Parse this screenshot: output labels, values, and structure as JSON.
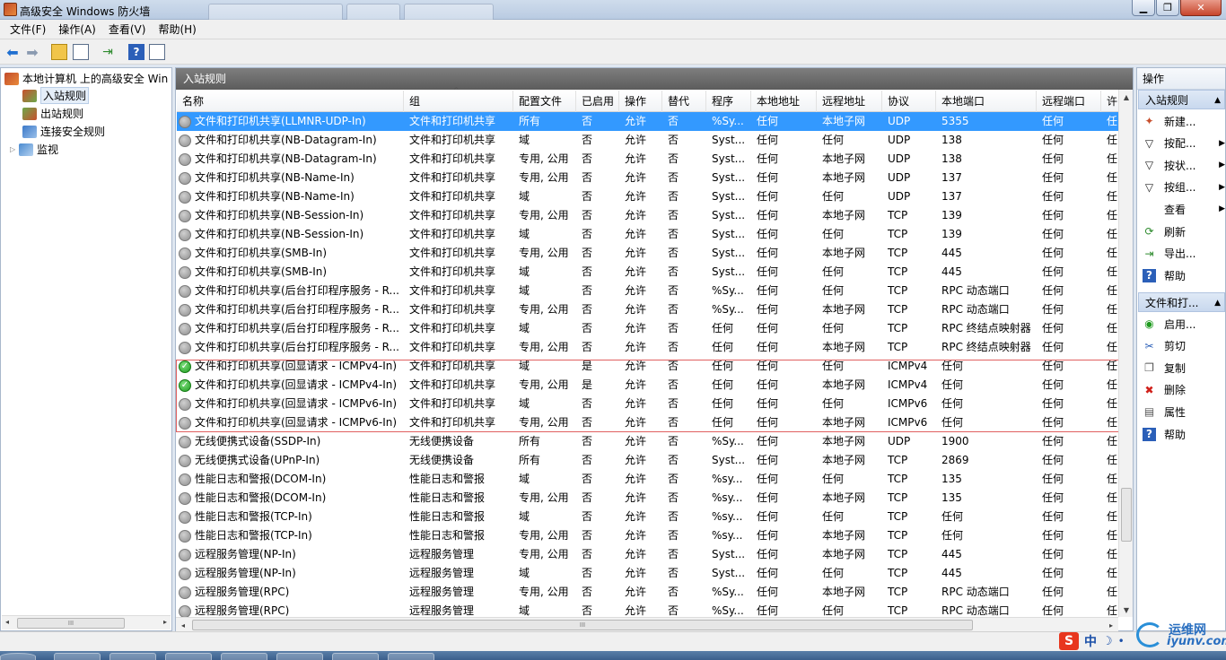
{
  "window": {
    "title": "高级安全 Windows 防火墙"
  },
  "menu": [
    "文件(F)",
    "操作(A)",
    "查看(V)",
    "帮助(H)"
  ],
  "tree": {
    "root": "本地计算机 上的高级安全 Win",
    "items": [
      {
        "label": "入站规则",
        "selected": true
      },
      {
        "label": "出站规则",
        "selected": false
      },
      {
        "label": "连接安全规则",
        "selected": false
      },
      {
        "label": "监视",
        "selected": false
      }
    ],
    "scroll_grip": "III"
  },
  "center": {
    "title": "入站规则",
    "columns": [
      "名称",
      "组",
      "配置文件",
      "已启用",
      "操作",
      "替代",
      "程序",
      "本地地址",
      "远程地址",
      "协议",
      "本地端口",
      "远程端口",
      "许"
    ],
    "scroll_grip": "III",
    "rows": [
      {
        "e": false,
        "v": [
          "文件和打印机共享(LLMNR-UDP-In)",
          "文件和打印机共享",
          "所有",
          "否",
          "允许",
          "否",
          "%Sy...",
          "任何",
          "本地子网",
          "UDP",
          "5355",
          "任何",
          "任"
        ]
      },
      {
        "e": false,
        "v": [
          "文件和打印机共享(NB-Datagram-In)",
          "文件和打印机共享",
          "域",
          "否",
          "允许",
          "否",
          "Syst...",
          "任何",
          "任何",
          "UDP",
          "138",
          "任何",
          "任"
        ]
      },
      {
        "e": false,
        "v": [
          "文件和打印机共享(NB-Datagram-In)",
          "文件和打印机共享",
          "专用, 公用",
          "否",
          "允许",
          "否",
          "Syst...",
          "任何",
          "本地子网",
          "UDP",
          "138",
          "任何",
          "任"
        ]
      },
      {
        "e": false,
        "v": [
          "文件和打印机共享(NB-Name-In)",
          "文件和打印机共享",
          "专用, 公用",
          "否",
          "允许",
          "否",
          "Syst...",
          "任何",
          "本地子网",
          "UDP",
          "137",
          "任何",
          "任"
        ]
      },
      {
        "e": false,
        "v": [
          "文件和打印机共享(NB-Name-In)",
          "文件和打印机共享",
          "域",
          "否",
          "允许",
          "否",
          "Syst...",
          "任何",
          "任何",
          "UDP",
          "137",
          "任何",
          "任"
        ]
      },
      {
        "e": false,
        "v": [
          "文件和打印机共享(NB-Session-In)",
          "文件和打印机共享",
          "专用, 公用",
          "否",
          "允许",
          "否",
          "Syst...",
          "任何",
          "本地子网",
          "TCP",
          "139",
          "任何",
          "任"
        ]
      },
      {
        "e": false,
        "v": [
          "文件和打印机共享(NB-Session-In)",
          "文件和打印机共享",
          "域",
          "否",
          "允许",
          "否",
          "Syst...",
          "任何",
          "任何",
          "TCP",
          "139",
          "任何",
          "任"
        ]
      },
      {
        "e": false,
        "v": [
          "文件和打印机共享(SMB-In)",
          "文件和打印机共享",
          "专用, 公用",
          "否",
          "允许",
          "否",
          "Syst...",
          "任何",
          "本地子网",
          "TCP",
          "445",
          "任何",
          "任"
        ]
      },
      {
        "e": false,
        "v": [
          "文件和打印机共享(SMB-In)",
          "文件和打印机共享",
          "域",
          "否",
          "允许",
          "否",
          "Syst...",
          "任何",
          "任何",
          "TCP",
          "445",
          "任何",
          "任"
        ]
      },
      {
        "e": false,
        "v": [
          "文件和打印机共享(后台打印程序服务 - R...",
          "文件和打印机共享",
          "域",
          "否",
          "允许",
          "否",
          "%Sy...",
          "任何",
          "任何",
          "TCP",
          "RPC 动态端口",
          "任何",
          "任"
        ]
      },
      {
        "e": false,
        "v": [
          "文件和打印机共享(后台打印程序服务 - R...",
          "文件和打印机共享",
          "专用, 公用",
          "否",
          "允许",
          "否",
          "%Sy...",
          "任何",
          "本地子网",
          "TCP",
          "RPC 动态端口",
          "任何",
          "任"
        ]
      },
      {
        "e": false,
        "v": [
          "文件和打印机共享(后台打印程序服务 - R...",
          "文件和打印机共享",
          "域",
          "否",
          "允许",
          "否",
          "任何",
          "任何",
          "任何",
          "TCP",
          "RPC 终结点映射器",
          "任何",
          "任"
        ]
      },
      {
        "e": false,
        "v": [
          "文件和打印机共享(后台打印程序服务 - R...",
          "文件和打印机共享",
          "专用, 公用",
          "否",
          "允许",
          "否",
          "任何",
          "任何",
          "本地子网",
          "TCP",
          "RPC 终结点映射器",
          "任何",
          "任"
        ]
      },
      {
        "e": true,
        "v": [
          "文件和打印机共享(回显请求 - ICMPv4-In)",
          "文件和打印机共享",
          "域",
          "是",
          "允许",
          "否",
          "任何",
          "任何",
          "任何",
          "ICMPv4",
          "任何",
          "任何",
          "任"
        ]
      },
      {
        "e": true,
        "v": [
          "文件和打印机共享(回显请求 - ICMPv4-In)",
          "文件和打印机共享",
          "专用, 公用",
          "是",
          "允许",
          "否",
          "任何",
          "任何",
          "本地子网",
          "ICMPv4",
          "任何",
          "任何",
          "任"
        ]
      },
      {
        "e": false,
        "v": [
          "文件和打印机共享(回显请求 - ICMPv6-In)",
          "文件和打印机共享",
          "域",
          "否",
          "允许",
          "否",
          "任何",
          "任何",
          "任何",
          "ICMPv6",
          "任何",
          "任何",
          "任"
        ]
      },
      {
        "e": false,
        "v": [
          "文件和打印机共享(回显请求 - ICMPv6-In)",
          "文件和打印机共享",
          "专用, 公用",
          "否",
          "允许",
          "否",
          "任何",
          "任何",
          "本地子网",
          "ICMPv6",
          "任何",
          "任何",
          "任"
        ]
      },
      {
        "e": false,
        "v": [
          "无线便携式设备(SSDP-In)",
          "无线便携设备",
          "所有",
          "否",
          "允许",
          "否",
          "%Sy...",
          "任何",
          "本地子网",
          "UDP",
          "1900",
          "任何",
          "任"
        ]
      },
      {
        "e": false,
        "v": [
          "无线便携式设备(UPnP-In)",
          "无线便携设备",
          "所有",
          "否",
          "允许",
          "否",
          "Syst...",
          "任何",
          "本地子网",
          "TCP",
          "2869",
          "任何",
          "任"
        ]
      },
      {
        "e": false,
        "v": [
          "性能日志和警报(DCOM-In)",
          "性能日志和警报",
          "域",
          "否",
          "允许",
          "否",
          "%sy...",
          "任何",
          "任何",
          "TCP",
          "135",
          "任何",
          "任"
        ]
      },
      {
        "e": false,
        "v": [
          "性能日志和警报(DCOM-In)",
          "性能日志和警报",
          "专用, 公用",
          "否",
          "允许",
          "否",
          "%sy...",
          "任何",
          "本地子网",
          "TCP",
          "135",
          "任何",
          "任"
        ]
      },
      {
        "e": false,
        "v": [
          "性能日志和警报(TCP-In)",
          "性能日志和警报",
          "域",
          "否",
          "允许",
          "否",
          "%sy...",
          "任何",
          "任何",
          "TCP",
          "任何",
          "任何",
          "任"
        ]
      },
      {
        "e": false,
        "v": [
          "性能日志和警报(TCP-In)",
          "性能日志和警报",
          "专用, 公用",
          "否",
          "允许",
          "否",
          "%sy...",
          "任何",
          "本地子网",
          "TCP",
          "任何",
          "任何",
          "任"
        ]
      },
      {
        "e": false,
        "v": [
          "远程服务管理(NP-In)",
          "远程服务管理",
          "专用, 公用",
          "否",
          "允许",
          "否",
          "Syst...",
          "任何",
          "本地子网",
          "TCP",
          "445",
          "任何",
          "任"
        ]
      },
      {
        "e": false,
        "v": [
          "远程服务管理(NP-In)",
          "远程服务管理",
          "域",
          "否",
          "允许",
          "否",
          "Syst...",
          "任何",
          "任何",
          "TCP",
          "445",
          "任何",
          "任"
        ]
      },
      {
        "e": false,
        "v": [
          "远程服务管理(RPC)",
          "远程服务管理",
          "专用, 公用",
          "否",
          "允许",
          "否",
          "%Sy...",
          "任何",
          "本地子网",
          "TCP",
          "RPC 动态端口",
          "任何",
          "任"
        ]
      },
      {
        "e": false,
        "v": [
          "远程服务管理(RPC)",
          "远程服务管理",
          "域",
          "否",
          "允许",
          "否",
          "%Sy...",
          "任何",
          "任何",
          "TCP",
          "RPC 动态端口",
          "任何",
          "任"
        ]
      }
    ]
  },
  "actions": {
    "title": "操作",
    "section1": "入站规则",
    "section1_items": [
      {
        "label": "新建...",
        "icon": "new-rule-icon",
        "sub": false
      },
      {
        "label": "按配...",
        "icon": "filter-icon",
        "sub": true
      },
      {
        "label": "按状...",
        "icon": "filter-icon",
        "sub": true
      },
      {
        "label": "按组...",
        "icon": "filter-icon",
        "sub": true
      },
      {
        "label": "查看",
        "icon": "",
        "sub": true
      },
      {
        "label": "刷新",
        "icon": "refresh-icon",
        "sub": false
      },
      {
        "label": "导出...",
        "icon": "export-icon",
        "sub": false
      },
      {
        "label": "帮助",
        "icon": "help-icon",
        "sub": false
      }
    ],
    "section2": "文件和打...",
    "section2_items": [
      {
        "label": "启用...",
        "icon": "enable-icon"
      },
      {
        "label": "剪切",
        "icon": "cut-icon"
      },
      {
        "label": "复制",
        "icon": "copy-icon"
      },
      {
        "label": "删除",
        "icon": "delete-icon"
      },
      {
        "label": "属性",
        "icon": "properties-icon"
      },
      {
        "label": "帮助",
        "icon": "help-icon"
      }
    ]
  },
  "tray": {
    "ime_logo": "S",
    "ime_lang": "中"
  },
  "watermark": {
    "cn": "运维网",
    "en": "iyunv.com"
  },
  "colors": {
    "selected_row": "#3399ff",
    "highlight_box": "#e06060",
    "enabled_icon": "#1e9a1e",
    "center_header": "#6a6a6a"
  }
}
